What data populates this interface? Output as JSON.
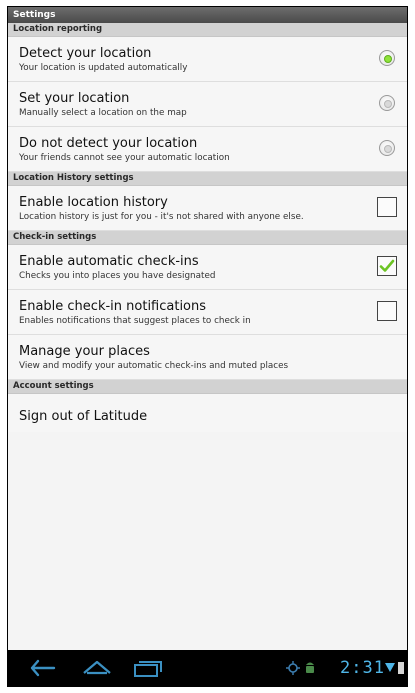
{
  "titlebar": {
    "title": "Settings"
  },
  "sections": {
    "location_reporting": "Location reporting",
    "location_history": "Location History settings",
    "checkin": "Check-in settings",
    "account": "Account settings"
  },
  "items": {
    "detect": {
      "title": "Detect your location",
      "sub": "Your location is updated automatically",
      "selected": true
    },
    "set": {
      "title": "Set your location",
      "sub": "Manually select a location on the map",
      "selected": false
    },
    "no_detect": {
      "title": "Do not detect your location",
      "sub": "Your friends cannot see your automatic location",
      "selected": false
    },
    "history": {
      "title": "Enable location history",
      "sub": "Location history is just for you - it's not shared with anyone else.",
      "checked": false
    },
    "auto_checkin": {
      "title": "Enable automatic check-ins",
      "sub": "Checks you into places you have designated",
      "checked": true
    },
    "checkin_notif": {
      "title": "Enable check-in notifications",
      "sub": "Enables notifications that suggest places to check in",
      "checked": false
    },
    "manage_places": {
      "title": "Manage your places",
      "sub": "View and modify your automatic check-ins and muted places"
    },
    "sign_out": {
      "title": "Sign out of Latitude"
    }
  },
  "status": {
    "time": "2:31"
  },
  "colors": {
    "accent_green": "#8fe33a",
    "clock_blue": "#4fb6e8",
    "nav_background": "#000000"
  },
  "icons": [
    "back-icon",
    "home-icon",
    "recent-apps-icon",
    "gps-icon",
    "android-debug-icon",
    "signal-icon",
    "battery-icon"
  ]
}
